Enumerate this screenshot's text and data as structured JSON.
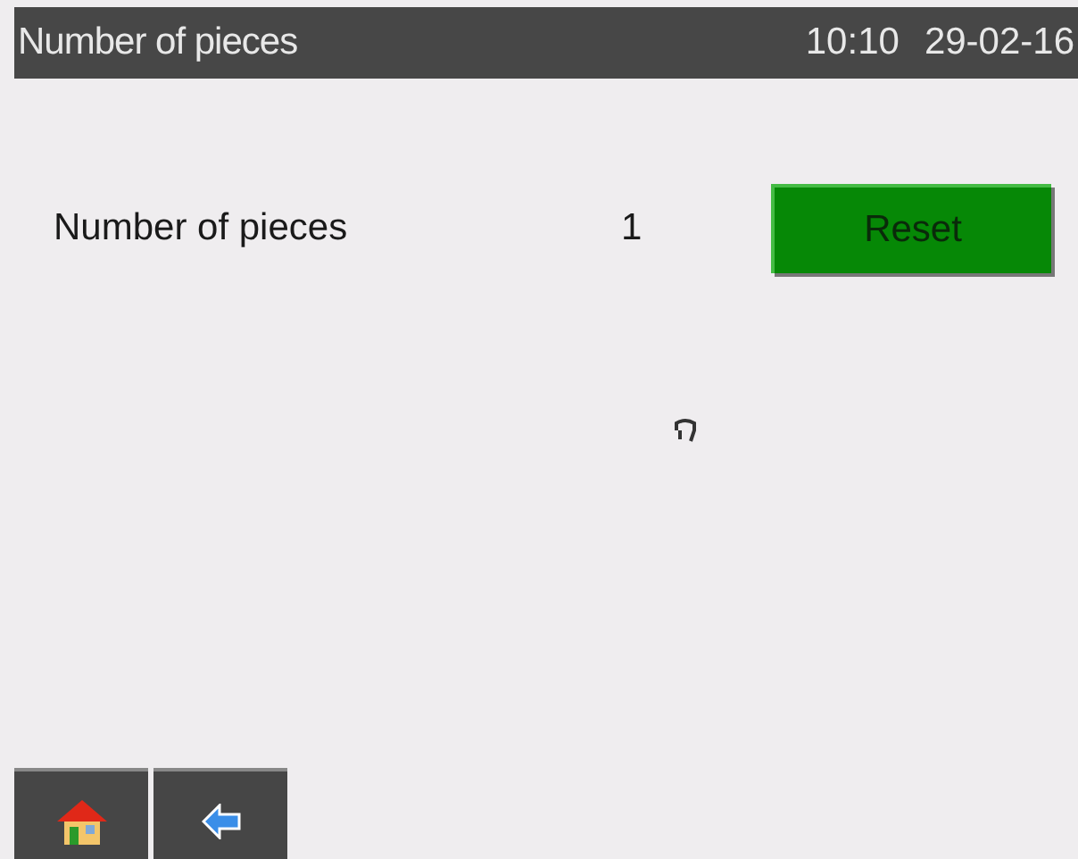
{
  "header": {
    "title": "Number of pieces",
    "time": "10:10",
    "date": "29-02-16"
  },
  "counter": {
    "label": "Number of pieces",
    "value": "1",
    "button": "Reset"
  },
  "nav_buttons": [
    {
      "kind": "home"
    },
    {
      "kind": "back"
    }
  ]
}
